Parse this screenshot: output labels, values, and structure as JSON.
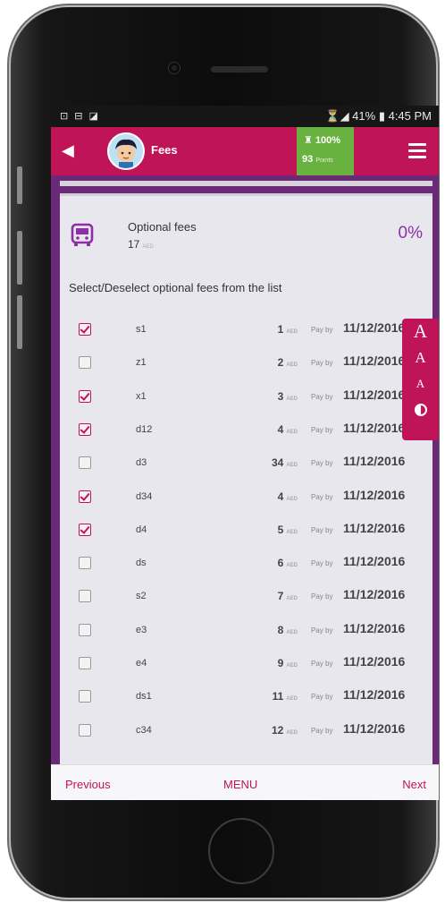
{
  "status_bar": {
    "left_icons": "⊡ ⊟ ◪",
    "right_text": "⏳◢ 41% ▮ 4:45 PM"
  },
  "appbar": {
    "back_icon": "back-arrow-icon",
    "title": "Fees",
    "progress_pct": "100%",
    "points": "93",
    "points_unit": "Points",
    "menu_icon": "hamburger-icon",
    "color": "#c01459"
  },
  "fees_summary": {
    "label": "Optional fees",
    "amount": "17",
    "currency": "AED",
    "percentage": "0%"
  },
  "instruction": "Select/Deselect optional fees from the list",
  "pay_by_label": "Pay by",
  "fees": [
    {
      "name": "s1",
      "amount": "1",
      "date": "11/12/2016",
      "checked": true
    },
    {
      "name": "z1",
      "amount": "2",
      "date": "11/12/2016",
      "checked": false
    },
    {
      "name": "x1",
      "amount": "3",
      "date": "11/12/2016",
      "checked": true
    },
    {
      "name": "d12",
      "amount": "4",
      "date": "11/12/2016",
      "checked": true
    },
    {
      "name": "d3",
      "amount": "34",
      "date": "11/12/2016",
      "checked": false
    },
    {
      "name": "d34",
      "amount": "4",
      "date": "11/12/2016",
      "checked": true
    },
    {
      "name": "d4",
      "amount": "5",
      "date": "11/12/2016",
      "checked": true
    },
    {
      "name": "ds",
      "amount": "6",
      "date": "11/12/2016",
      "checked": false
    },
    {
      "name": "s2",
      "amount": "7",
      "date": "11/12/2016",
      "checked": false
    },
    {
      "name": "e3",
      "amount": "8",
      "date": "11/12/2016",
      "checked": false
    },
    {
      "name": "e4",
      "amount": "9",
      "date": "11/12/2016",
      "checked": false
    },
    {
      "name": "ds1",
      "amount": "11",
      "date": "11/12/2016",
      "checked": false
    },
    {
      "name": "c34",
      "amount": "12",
      "date": "11/12/2016",
      "checked": false
    }
  ],
  "accessibility": {
    "large": "A",
    "medium": "A",
    "small": "A"
  },
  "footer": {
    "previous": "Previous",
    "menu": "MENU",
    "next": "Next"
  }
}
